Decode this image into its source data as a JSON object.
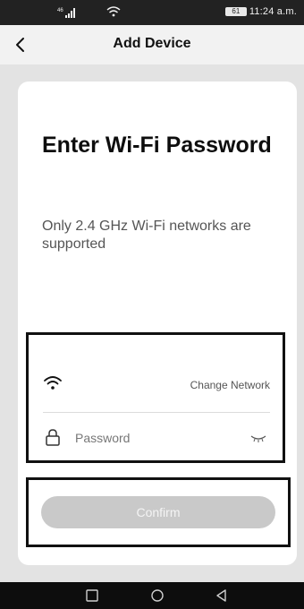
{
  "status_bar": {
    "signal_label": "⁴⁶",
    "battery": "61",
    "clock": "11:24 a.m."
  },
  "header": {
    "title": "Add Device",
    "back_icon": "chevron-left-icon"
  },
  "card": {
    "headline": "Enter Wi-Fi Password",
    "subtext": "Only 2.4 GHz Wi-Fi networks are supported"
  },
  "network": {
    "wifi_icon": "wifi-icon",
    "change_label": "Change Network"
  },
  "password": {
    "lock_icon": "lock-icon",
    "placeholder": "Password",
    "value": "",
    "toggle_icon": "eye-closed-icon"
  },
  "confirm": {
    "label": "Confirm"
  },
  "nav_bar": {
    "buttons": [
      "square-recents-icon",
      "circle-home-icon",
      "triangle-back-icon"
    ]
  }
}
